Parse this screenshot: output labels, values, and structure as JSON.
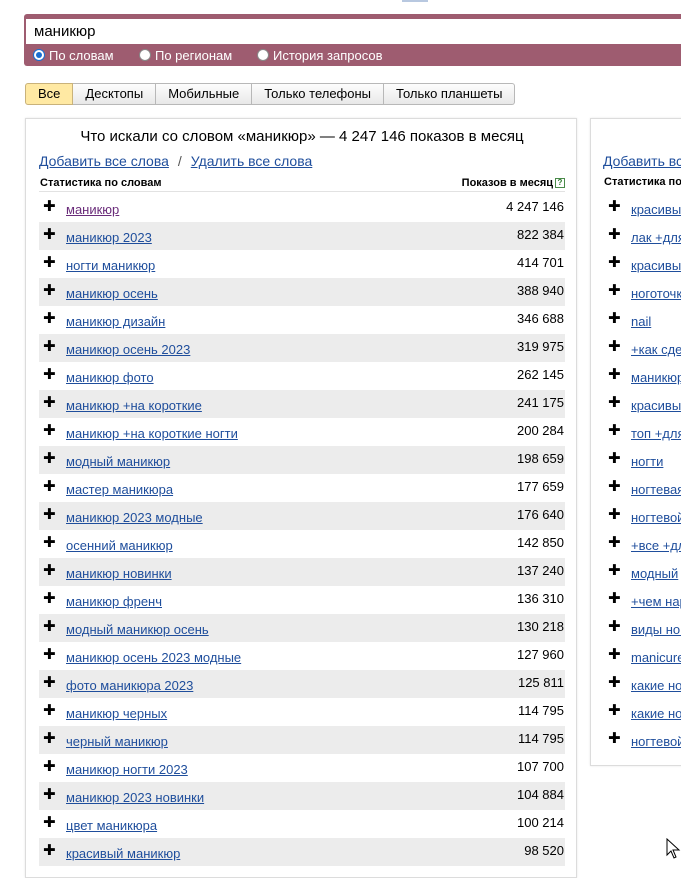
{
  "search": {
    "query": "маникюр",
    "modes": [
      {
        "label": "По словам",
        "checked": true
      },
      {
        "label": "По регионам",
        "checked": false
      },
      {
        "label": "История запросов",
        "checked": false
      }
    ]
  },
  "tabs": [
    "Все",
    "Десктопы",
    "Мобильные",
    "Только телефоны",
    "Только планшеты"
  ],
  "active_tab": "Все",
  "main_panel": {
    "title": "Что искали со словом «маникюр» — 4 247 146 показов в месяц",
    "add_all": "Добавить все слова",
    "separator": "/",
    "remove_all": "Удалить все слова",
    "col_left": "Статистика по словам",
    "col_right": "Показов в месяц",
    "help_glyph": "?",
    "plus_glyph": "✚",
    "rows": [
      {
        "kw": "маникюр",
        "count": "4 247 146"
      },
      {
        "kw": "маникюр 2023",
        "count": "822 384"
      },
      {
        "kw": "ногти маникюр",
        "count": "414 701"
      },
      {
        "kw": "маникюр осень",
        "count": "388 940"
      },
      {
        "kw": "маникюр дизайн",
        "count": "346 688"
      },
      {
        "kw": "маникюр осень 2023",
        "count": "319 975"
      },
      {
        "kw": "маникюр фото",
        "count": "262 145"
      },
      {
        "kw": "маникюр +на короткие",
        "count": "241 175"
      },
      {
        "kw": "маникюр +на короткие ногти",
        "count": "200 284"
      },
      {
        "kw": "модный маникюр",
        "count": "198 659"
      },
      {
        "kw": "мастер маникюра",
        "count": "177 659"
      },
      {
        "kw": "маникюр 2023 модные",
        "count": "176 640"
      },
      {
        "kw": "осенний маникюр",
        "count": "142 850"
      },
      {
        "kw": "маникюр новинки",
        "count": "137 240"
      },
      {
        "kw": "маникюр френч",
        "count": "136 310"
      },
      {
        "kw": "модный маникюр осень",
        "count": "130 218"
      },
      {
        "kw": "маникюр осень 2023 модные",
        "count": "127 960"
      },
      {
        "kw": "фото маникюра 2023",
        "count": "125 811"
      },
      {
        "kw": "маникюр черных",
        "count": "114 795"
      },
      {
        "kw": "черный маникюр",
        "count": "114 795"
      },
      {
        "kw": "маникюр ногти 2023",
        "count": "107 700"
      },
      {
        "kw": "маникюр 2023 новинки",
        "count": "104 884"
      },
      {
        "kw": "цвет маникюра",
        "count": "100 214"
      },
      {
        "kw": "красивый маникюр",
        "count": "98 520"
      }
    ]
  },
  "side_panel": {
    "add_all": "Добавить вс",
    "col_left": "Статистика по",
    "rows": [
      "красивы",
      "лак +для",
      "красивы",
      "ноготочк",
      "nail",
      "+как сде",
      "маникюр",
      "красивы",
      "топ +для",
      "ногти",
      "ногтевая",
      "ногтевой",
      "+все +дл",
      "модный",
      "+чем нар",
      "виды ног",
      "manicure",
      "какие но",
      "какие но",
      "ногтевой"
    ]
  },
  "colors": {
    "header_bg": "#9e5c70",
    "link": "#1f4e9c",
    "visited_link": "#6a2c7a",
    "active_tab": "#ffe9a3",
    "alt_row": "#ececec"
  }
}
